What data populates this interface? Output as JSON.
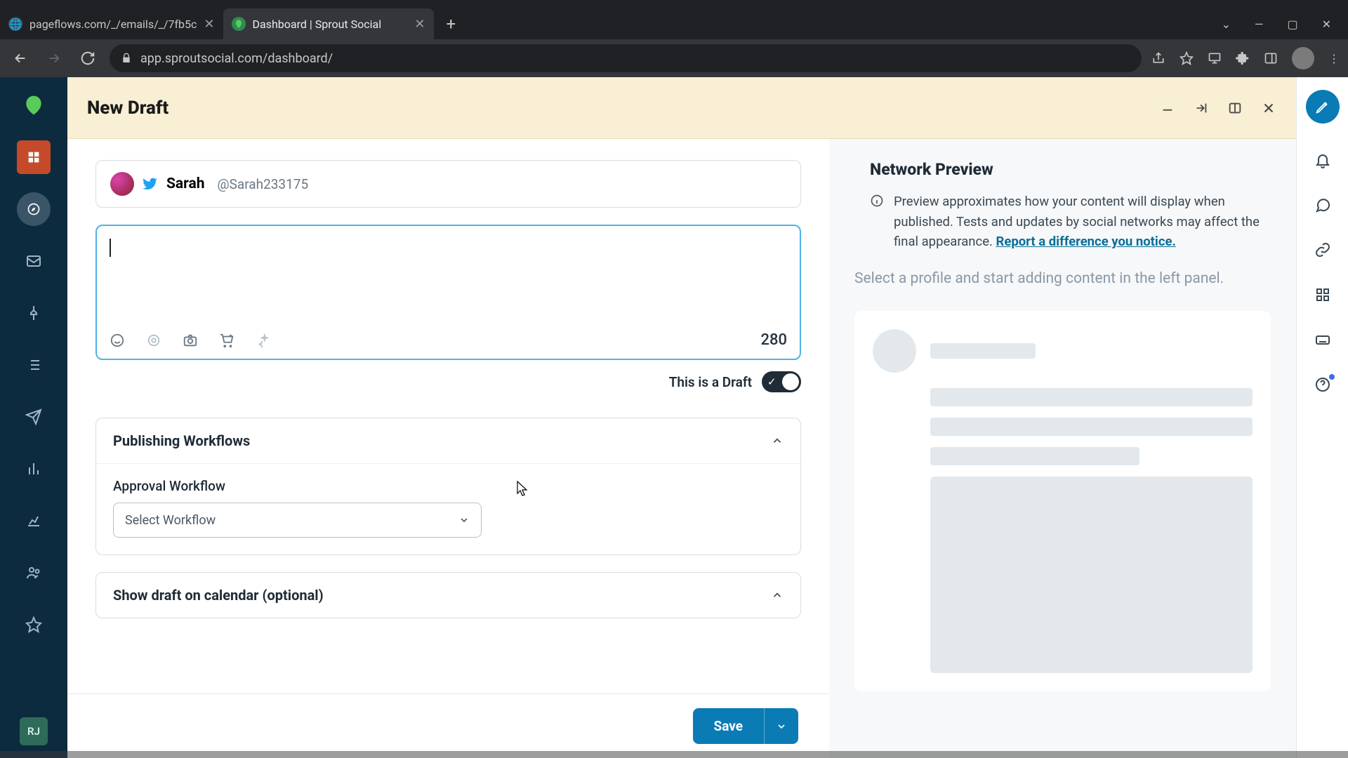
{
  "browser": {
    "tabs": [
      {
        "title": "pageflows.com/_/emails/_/7fb5c"
      },
      {
        "title": "Dashboard | Sprout Social"
      }
    ],
    "url": "app.sproutsocial.com/dashboard/"
  },
  "header": {
    "title": "New Draft"
  },
  "profile": {
    "name": "Sarah",
    "handle": "@Sarah233175"
  },
  "composer": {
    "char_count": "280",
    "draft_label": "This is a Draft"
  },
  "workflows": {
    "section_title": "Publishing Workflows",
    "approval_label": "Approval Workflow",
    "select_placeholder": "Select Workflow"
  },
  "calendar_section": {
    "title": "Show draft on calendar (optional)"
  },
  "preview": {
    "title": "Network Preview",
    "info_text": "Preview approximates how your content will display when published. Tests and updates by social networks may affect the final appearance. ",
    "info_link": "Report a difference you notice.",
    "placeholder": "Select a profile and start adding content in the left panel."
  },
  "footer": {
    "save_label": "Save"
  },
  "left_rail_user": "RJ"
}
